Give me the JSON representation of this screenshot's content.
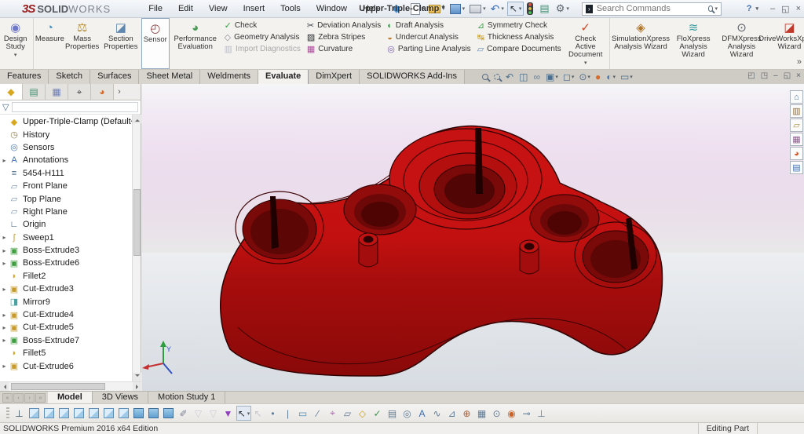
{
  "window": {
    "brand_ds": "3S",
    "brand_bold": "SOLID",
    "brand_light": "WORKS",
    "doc_title": "Upper-Triple-Clamp *",
    "help_label": "?",
    "minimize": "–",
    "restore": "◱",
    "close": "×",
    "menus": [
      {
        "name": "menu-file",
        "label": "File"
      },
      {
        "name": "menu-edit",
        "label": "Edit"
      },
      {
        "name": "menu-view",
        "label": "View"
      },
      {
        "name": "menu-insert",
        "label": "Insert"
      },
      {
        "name": "menu-tools",
        "label": "Tools"
      },
      {
        "name": "menu-window",
        "label": "Window"
      },
      {
        "name": "menu-help",
        "label": "Help"
      }
    ],
    "quick_icons": [
      {
        "name": "new-document-icon",
        "cls": "qi-new",
        "dd": "▾"
      },
      {
        "name": "open-document-icon",
        "cls": "qi-open",
        "dd": "▾"
      },
      {
        "name": "save-icon",
        "cls": "qi-save",
        "dd": "▾"
      },
      {
        "name": "print-icon",
        "cls": "qi-print",
        "dd": "▾"
      },
      {
        "name": "undo-icon",
        "cls": "qi-undo",
        "glyph": "↶",
        "dd": "▾"
      },
      {
        "name": "select-tool-icon",
        "cls": "qi-select",
        "glyph": "↖",
        "dd": "▾",
        "state": "pressed"
      },
      {
        "name": "rebuild-icon",
        "cls": "qi-light"
      },
      {
        "name": "file-properties-icon",
        "cls": "qi-props",
        "glyph": "▤"
      },
      {
        "name": "options-icon",
        "cls": "qi-gear",
        "glyph": "⚙",
        "dd": "▾"
      }
    ]
  },
  "search": {
    "placeholder": "Search Commands",
    "icon_glyph": "›"
  },
  "ribbon": {
    "overflow": "»",
    "large": [
      {
        "name": "design-study-button",
        "label": "Design Study",
        "glyph": "◉",
        "color": "#6f79c8",
        "dd": "▾",
        "sep": "1"
      },
      {
        "name": "measure-button",
        "label": "Measure",
        "glyph": "◔",
        "color": "#3f8fbf"
      },
      {
        "name": "mass-properties-button",
        "label": "Mass Properties",
        "glyph": "⚖",
        "color": "#b58a2a"
      },
      {
        "name": "section-properties-button",
        "label": "Section Properties",
        "glyph": "◪",
        "color": "#5f87b0"
      },
      {
        "name": "sensor-button",
        "label": "Sensor",
        "glyph": "◴",
        "color": "#8a4040",
        "state": "selected"
      },
      {
        "name": "performance-evaluation-button",
        "label": "Performance Evaluation",
        "glyph": "◕",
        "color": "#4a9a55"
      }
    ],
    "col1": [
      {
        "name": "check-button",
        "label": "Check",
        "glyph": "✓",
        "color": "#2f9e3f"
      },
      {
        "name": "geometry-analysis-button",
        "label": "Geometry Analysis",
        "glyph": "◇",
        "color": "#8a8f99"
      },
      {
        "name": "import-diagnostics-button",
        "label": "Import Diagnostics",
        "glyph": "▥",
        "color": "#b9bec6",
        "state": "disabled"
      }
    ],
    "col2": [
      {
        "name": "deviation-analysis-button",
        "label": "Deviation Analysis",
        "glyph": "✂",
        "color": "#3a3f44"
      },
      {
        "name": "zebra-stripes-button",
        "label": "Zebra Stripes",
        "glyph": "▨",
        "color": "#23272b"
      },
      {
        "name": "curvature-button",
        "label": "Curvature",
        "glyph": "▦",
        "color": "#b04a9e"
      }
    ],
    "col3": [
      {
        "name": "draft-analysis-button",
        "label": "Draft Analysis",
        "glyph": "◐",
        "color": "#3a9e4a"
      },
      {
        "name": "undercut-analysis-button",
        "label": "Undercut Analysis",
        "glyph": "◒",
        "color": "#c07a2a"
      },
      {
        "name": "parting-line-analysis-button",
        "label": "Parting Line Analysis",
        "glyph": "◎",
        "color": "#7a5fb0"
      }
    ],
    "col4": [
      {
        "name": "symmetry-check-button",
        "label": "Symmetry Check",
        "glyph": "⊿",
        "color": "#3a9e4a"
      },
      {
        "name": "thickness-analysis-button",
        "label": "Thickness Analysis",
        "glyph": "↹",
        "color": "#c8a020"
      },
      {
        "name": "compare-documents-button",
        "label": "Compare Documents",
        "glyph": "▱",
        "color": "#5f87b0"
      }
    ],
    "right_large": [
      {
        "name": "check-active-document-button",
        "label": "Check Active Document",
        "glyph": "✓",
        "color": "#c84a2a",
        "dd": "▾",
        "sep": "1"
      },
      {
        "name": "simulationxpress-wizard-button",
        "label": "SimulationXpress Analysis Wizard",
        "glyph": "◈",
        "color": "#b0762a"
      },
      {
        "name": "floxpress-wizard-button",
        "label": "FloXpress Analysis Wizard",
        "glyph": "≋",
        "color": "#3a9e9e"
      },
      {
        "name": "dfmxpress-wizard-button",
        "label": "DFMXpress Analysis Wizard",
        "glyph": "⊙",
        "color": "#5a5f66"
      },
      {
        "name": "driveworksxpress-wizard-button",
        "label": "DriveWorksXpress Wizard",
        "glyph": "◪",
        "color": "#c0392b"
      }
    ]
  },
  "command_tabs": [
    {
      "name": "tab-features",
      "label": "Features"
    },
    {
      "name": "tab-sketch",
      "label": "Sketch"
    },
    {
      "name": "tab-surfaces",
      "label": "Surfaces"
    },
    {
      "name": "tab-sheet-metal",
      "label": "Sheet Metal"
    },
    {
      "name": "tab-weldments",
      "label": "Weldments"
    },
    {
      "name": "tab-evaluate",
      "label": "Evaluate",
      "state": "active"
    },
    {
      "name": "tab-dimxpert",
      "label": "DimXpert"
    },
    {
      "name": "tab-solidworks-add-ins",
      "label": "SOLIDWORKS Add-Ins"
    }
  ],
  "headsup": [
    {
      "name": "zoom-fit-icon",
      "cls": "mg"
    },
    {
      "name": "zoom-area-icon",
      "cls": "mg dashed"
    },
    {
      "name": "previous-view-icon",
      "glyph": "↶",
      "color": "#4a6f8f"
    },
    {
      "name": "section-view-icon",
      "glyph": "◫",
      "color": "#4a6f8f"
    },
    {
      "name": "annotation-views-icon",
      "glyph": "∞",
      "color": "#6a7f94"
    },
    {
      "name": "view-orientation-icon",
      "glyph": "▣",
      "color": "#4a6f8f",
      "dd": "▾"
    },
    {
      "name": "display-style-icon",
      "glyph": "◻",
      "color": "#4a6f8f",
      "dd": "▾"
    },
    {
      "name": "hide-show-items-icon",
      "glyph": "⊙",
      "color": "#4a6f8f",
      "dd": "▾"
    },
    {
      "name": "edit-appearance-icon",
      "glyph": "●",
      "color": "#d86a2a"
    },
    {
      "name": "apply-scene-icon",
      "glyph": "◐",
      "color": "#4a7ab0",
      "dd": "▾"
    },
    {
      "name": "view-settings-icon",
      "glyph": "▭",
      "color": "#4a6f8f",
      "dd": "▾"
    }
  ],
  "doc_controls": [
    {
      "name": "doc-pane-left-icon",
      "glyph": "◰"
    },
    {
      "name": "doc-pane-right-icon",
      "glyph": "◳"
    },
    {
      "name": "doc-minimize-icon",
      "glyph": "–"
    },
    {
      "name": "doc-restore-icon",
      "glyph": "◱"
    },
    {
      "name": "doc-close-icon",
      "glyph": "×"
    }
  ],
  "panel": {
    "tabs": [
      {
        "name": "featuremanager-tab",
        "glyph": "◆",
        "color": "#d8a820",
        "state": "active"
      },
      {
        "name": "propertymanager-tab",
        "glyph": "▤",
        "color": "#3f8f6f"
      },
      {
        "name": "configurationmanager-tab",
        "glyph": "▦",
        "color": "#6f7fb5"
      },
      {
        "name": "dimxpertmanager-tab",
        "glyph": "⌖",
        "color": "#444444"
      },
      {
        "name": "displaymanager-tab",
        "glyph": "◕",
        "color": "#d86a2a"
      }
    ],
    "tabs_more": "›",
    "filter_glyph": "▽",
    "tree_root": {
      "label": "Upper-Triple-Clamp  (Default<<Defau",
      "glyph": "◆",
      "color": "#d8a820"
    },
    "tree_items": [
      {
        "name": "tree-item-history",
        "label": "History",
        "glyph": "◷",
        "color": "#8a7a4a"
      },
      {
        "name": "tree-item-sensors",
        "label": "Sensors",
        "glyph": "◎",
        "color": "#4a7ab0"
      },
      {
        "name": "tree-item-annotations",
        "label": "Annotations",
        "glyph": "A",
        "color": "#3f6fb5",
        "arrow": "▸"
      },
      {
        "name": "tree-item-material-5454-H111",
        "label": "5454-H111",
        "glyph": "≡",
        "color": "#4a6b8a"
      },
      {
        "name": "tree-item-front-plane",
        "label": "Front Plane",
        "glyph": "▱",
        "color": "#7a92ad"
      },
      {
        "name": "tree-item-top-plane",
        "label": "Top Plane",
        "glyph": "▱",
        "color": "#7a92ad"
      },
      {
        "name": "tree-item-right-plane",
        "label": "Right Plane",
        "glyph": "▱",
        "color": "#7a92ad"
      },
      {
        "name": "tree-item-origin",
        "label": "Origin",
        "glyph": "∟",
        "color": "#33506e"
      },
      {
        "name": "tree-item-sweep1",
        "label": "Sweep1",
        "glyph": "∫",
        "color": "#c89a2a",
        "arrow": "▸"
      },
      {
        "name": "tree-item-boss-extrude3",
        "label": "Boss-Extrude3",
        "glyph": "▣",
        "color": "#3f9e3f",
        "arrow": "▸"
      },
      {
        "name": "tree-item-boss-extrude6",
        "label": "Boss-Extrude6",
        "glyph": "▣",
        "color": "#3f9e3f",
        "arrow": "▸"
      },
      {
        "name": "tree-item-fillet2",
        "label": "Fillet2",
        "glyph": "◗",
        "color": "#d9a520"
      },
      {
        "name": "tree-item-cut-extrude3",
        "label": "Cut-Extrude3",
        "glyph": "▣",
        "color": "#c89a2a",
        "arrow": "▸"
      },
      {
        "name": "tree-item-mirror9",
        "label": "Mirror9",
        "glyph": "◨",
        "color": "#4aa3a0"
      },
      {
        "name": "tree-item-cut-extrude4",
        "label": "Cut-Extrude4",
        "glyph": "▣",
        "color": "#c89a2a",
        "arrow": "▸"
      },
      {
        "name": "tree-item-cut-extrude5",
        "label": "Cut-Extrude5",
        "glyph": "▣",
        "color": "#c89a2a",
        "arrow": "▸"
      },
      {
        "name": "tree-item-boss-extrude7",
        "label": "Boss-Extrude7",
        "glyph": "▣",
        "color": "#3f9e3f",
        "arrow": "▸"
      },
      {
        "name": "tree-item-fillet5",
        "label": "Fillet5",
        "glyph": "◗",
        "color": "#d9a520"
      },
      {
        "name": "tree-item-cut-extrude6",
        "label": "Cut-Extrude6",
        "glyph": "▣",
        "color": "#c89a2a",
        "arrow": "▸"
      }
    ]
  },
  "viewport": {
    "triad_y_label": "Y",
    "part_color_top": "#cf1313",
    "part_color_side": "#8c0909",
    "taskpane_icons": [
      {
        "name": "solidworks-resources-icon",
        "glyph": "⌂",
        "color": "#4a6b8a"
      },
      {
        "name": "design-library-icon",
        "glyph": "▥",
        "color": "#8a6b3a"
      },
      {
        "name": "file-explorer-icon",
        "glyph": "▱",
        "color": "#b08a3a"
      },
      {
        "name": "view-palette-icon",
        "glyph": "▦",
        "color": "#8a5a8a"
      },
      {
        "name": "appearances-icon",
        "glyph": "◕",
        "color": "#d85a2a"
      },
      {
        "name": "custom-properties-icon",
        "glyph": "▤",
        "color": "#3f6fb5"
      }
    ]
  },
  "bottom": {
    "nav_icons": [
      {
        "name": "first-tab-icon",
        "glyph": "«"
      },
      {
        "name": "prev-tab-icon",
        "glyph": "‹"
      },
      {
        "name": "next-tab-icon",
        "glyph": "›"
      },
      {
        "name": "last-tab-icon",
        "glyph": "»"
      }
    ],
    "tabs": [
      {
        "name": "model-tab",
        "label": "Model",
        "state": "active"
      },
      {
        "name": "3d-views-tab",
        "label": "3D Views"
      },
      {
        "name": "motion-study-1-tab",
        "label": "Motion Study 1"
      }
    ],
    "toolbar_icons": [
      {
        "name": "update-standard-views-icon",
        "glyph": "⊥",
        "color": "#35505f"
      },
      {
        "name": "view-front-icon",
        "cls": "bc-out"
      },
      {
        "name": "view-back-icon",
        "cls": "bc-out"
      },
      {
        "name": "view-left-icon",
        "cls": "bc-out"
      },
      {
        "name": "view-right-icon",
        "cls": "bc-out"
      },
      {
        "name": "view-top-icon",
        "cls": "bc-out"
      },
      {
        "name": "view-bottom-icon",
        "cls": "bc-out"
      },
      {
        "name": "view-normal-to-icon",
        "cls": "bc-out"
      },
      {
        "name": "view-isometric-icon",
        "cls": "bc-solid"
      },
      {
        "name": "view-trimetric-icon",
        "cls": "bc-solid"
      },
      {
        "name": "view-dimetric-icon",
        "cls": "bc-solid"
      },
      {
        "name": "view-selector-icon",
        "glyph": "✐",
        "color": "#7a8294"
      },
      {
        "name": "filter-toggle-icon",
        "glyph": "▽",
        "color": "#c9ccd4",
        "state": "disabled"
      },
      {
        "name": "clear-all-filters-icon",
        "glyph": "▽",
        "color": "#c9ccd4",
        "state": "disabled"
      },
      {
        "name": "filter-all-icon",
        "glyph": "▼",
        "color": "#8f3fbf"
      },
      {
        "name": "select-arrow-icon",
        "glyph": "↖",
        "color": "#2a2f36",
        "state": "pressed",
        "dd": "▾"
      },
      {
        "name": "lasso-select-icon",
        "glyph": "↖",
        "color": "#c2c6cc",
        "state": "disabled"
      },
      {
        "name": "filter-vertices-icon",
        "glyph": "•",
        "color": "#5f7a94"
      },
      {
        "name": "filter-midpoints-icon",
        "glyph": "|",
        "color": "#5f7a94"
      },
      {
        "name": "filter-faces-icon",
        "glyph": "▭",
        "color": "#4a8fb8"
      },
      {
        "name": "filter-edges-icon",
        "glyph": "∕",
        "color": "#5f7a94"
      },
      {
        "name": "filter-axes-icon",
        "glyph": "⌖",
        "color": "#b05fb0"
      },
      {
        "name": "filter-planes-icon",
        "glyph": "▱",
        "color": "#5f7a94"
      },
      {
        "name": "filter-sketch-segments-icon",
        "glyph": "◇",
        "color": "#c8a020"
      },
      {
        "name": "filter-dimensions-icon",
        "glyph": "✓",
        "color": "#3f8f4f"
      },
      {
        "name": "filter-notes-icon",
        "glyph": "▤",
        "color": "#5f7a94"
      },
      {
        "name": "filter-balloons-icon",
        "glyph": "◎",
        "color": "#5f7a94"
      },
      {
        "name": "filter-annotations-icon",
        "glyph": "A",
        "color": "#3f6fb5"
      },
      {
        "name": "filter-surface-finish-icon",
        "glyph": "∿",
        "color": "#5f7a94"
      },
      {
        "name": "filter-weld-symbols-icon",
        "glyph": "⊿",
        "color": "#5f7a94"
      },
      {
        "name": "filter-datums-icon",
        "glyph": "⊕",
        "color": "#a05f3f"
      },
      {
        "name": "filter-blocks-icon",
        "glyph": "▦",
        "color": "#5f7a94"
      },
      {
        "name": "filter-cosmetic-threads-icon",
        "glyph": "⊙",
        "color": "#5f7a94"
      },
      {
        "name": "filter-connection-points-icon",
        "glyph": "◉",
        "color": "#c8642a"
      },
      {
        "name": "filter-routing-points-icon",
        "glyph": "⊸",
        "color": "#5f7a94"
      },
      {
        "name": "filter-coordinate-systems-icon",
        "glyph": "⊥",
        "color": "#5f7a94"
      }
    ]
  },
  "statusbar": {
    "left": "SOLIDWORKS Premium 2016 x64 Edition",
    "right": "Editing Part"
  }
}
